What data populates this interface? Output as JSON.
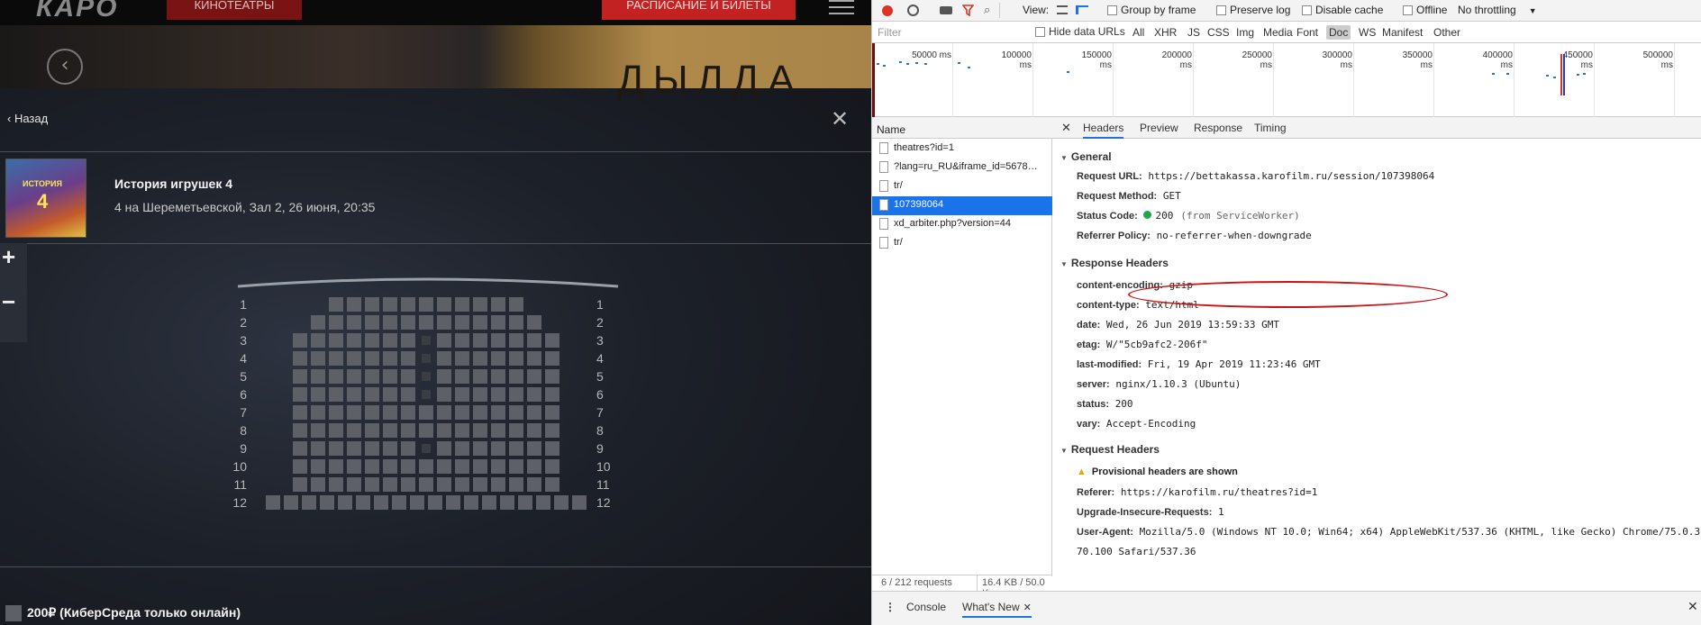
{
  "site": {
    "logo": "КАРО",
    "nav_cinemas": "КИНОТЕАТРЫ",
    "nav_tickets": "РАСПИСАНИЕ И БИЛЕТЫ",
    "banner_title": "ДЫЛДА",
    "back_label": "Назад",
    "close_label": "✕",
    "movie_title": "История игрушек 4",
    "movie_info": "4 на Шереметьевской, Зал 2, 26 июня, 20:35",
    "poster_title": "ИСТОРИЯ",
    "poster_number": "4",
    "zoom_in": "+",
    "zoom_out": "−",
    "price_label": "200₽ (КиберСреда только онлайн)"
  },
  "seatmap": {
    "rows": [
      "1",
      "2",
      "3",
      "4",
      "5",
      "6",
      "7",
      "8",
      "9",
      "10",
      "11",
      "12"
    ],
    "row_seat_counts": [
      11,
      13,
      15,
      15,
      15,
      15,
      15,
      15,
      15,
      15,
      15,
      18
    ]
  },
  "devtools": {
    "toolbar": {
      "view_label": "View:",
      "group_by_frame": "Group by frame",
      "preserve_log": "Preserve log",
      "disable_cache": "Disable cache",
      "offline": "Offline",
      "throttling": "No throttling"
    },
    "filter_placeholder": "Filter",
    "hide_data_urls": "Hide data URLs",
    "filter_types": [
      "All",
      "XHR",
      "JS",
      "CSS",
      "Img",
      "Media",
      "Font",
      "Doc",
      "WS",
      "Manifest",
      "Other"
    ],
    "selected_filter": "Doc",
    "timeline_ticks": [
      "50000 ms",
      "100000 ms",
      "150000 ms",
      "200000 ms",
      "250000 ms",
      "300000 ms",
      "350000 ms",
      "400000 ms",
      "450000 ms",
      "500000 ms"
    ],
    "name_header": "Name",
    "requests": [
      "theatres?id=1",
      "?lang=ru_RU&iframe_id=5678…",
      "tr/",
      "107398064",
      "xd_arbiter.php?version=44",
      "tr/"
    ],
    "selected_request": "107398064",
    "status_requests": "6 / 212 requests",
    "status_size": "16.4 KB / 50.0 K",
    "detail_tabs": [
      "Headers",
      "Preview",
      "Response",
      "Timing"
    ],
    "active_tab": "Headers",
    "general": {
      "title": "General",
      "request_url_label": "Request URL:",
      "request_url": "https://bettakassa.karofilm.ru/session/107398064",
      "request_method_label": "Request Method:",
      "request_method": "GET",
      "status_code_label": "Status Code:",
      "status_code": "200",
      "status_note": "(from ServiceWorker)",
      "referrer_policy_label": "Referrer Policy:",
      "referrer_policy": "no-referrer-when-downgrade"
    },
    "response_headers": {
      "title": "Response Headers",
      "items": [
        {
          "k": "content-encoding:",
          "v": "gzip"
        },
        {
          "k": "content-type:",
          "v": "text/html"
        },
        {
          "k": "date:",
          "v": "Wed, 26 Jun 2019 13:59:33 GMT"
        },
        {
          "k": "etag:",
          "v": "W/\"5cb9afc2-206f\""
        },
        {
          "k": "last-modified:",
          "v": "Fri, 19 Apr 2019 11:23:46 GMT"
        },
        {
          "k": "server:",
          "v": "nginx/1.10.3 (Ubuntu)"
        },
        {
          "k": "status:",
          "v": "200"
        },
        {
          "k": "vary:",
          "v": "Accept-Encoding"
        }
      ]
    },
    "request_headers": {
      "title": "Request Headers",
      "provisional": "Provisional headers are shown",
      "items": [
        {
          "k": "Referer:",
          "v": "https://karofilm.ru/theatres?id=1"
        },
        {
          "k": "Upgrade-Insecure-Requests:",
          "v": "1"
        },
        {
          "k": "User-Agent:",
          "v": "Mozilla/5.0 (Windows NT 10.0; Win64; x64) AppleWebKit/537.36 (KHTML, like Gecko) Chrome/75.0.3"
        }
      ],
      "ua_cont": "70.100 Safari/537.36"
    },
    "bottom_tabs": [
      "Console",
      "What's New"
    ],
    "bottom_active": "What's New"
  }
}
